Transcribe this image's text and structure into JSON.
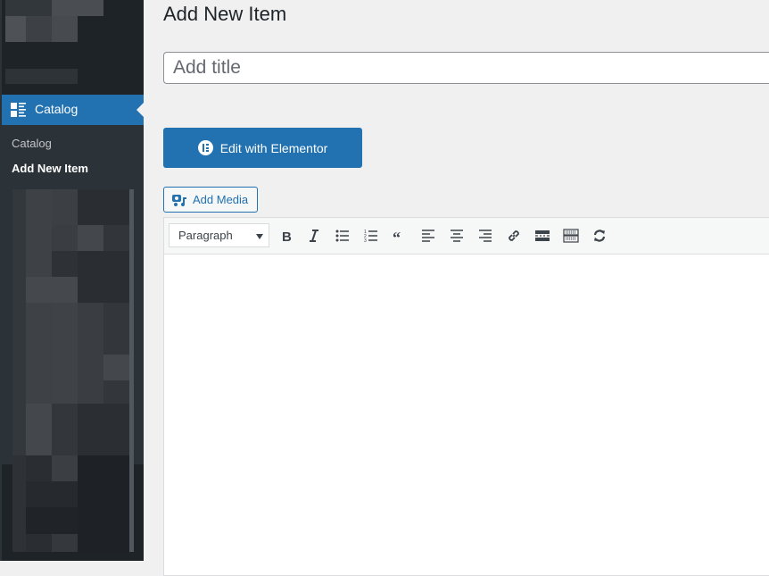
{
  "sidebar": {
    "active_menu": {
      "label": "Catalog",
      "icon": "catalog-icon"
    },
    "submenu": [
      {
        "label": "Catalog",
        "current": false
      },
      {
        "label": "Add New Item",
        "current": true
      }
    ]
  },
  "main": {
    "page_title": "Add New Item",
    "title_input": {
      "value": "",
      "placeholder": "Add title"
    },
    "elementor_button": {
      "label": "Edit with Elementor",
      "icon": "elementor-icon"
    },
    "add_media_button": {
      "label": "Add Media",
      "icon": "add-media-icon"
    },
    "editor": {
      "format_select": {
        "selected": "Paragraph"
      },
      "toolbar_buttons": [
        {
          "name": "bold",
          "icon": "bold-icon"
        },
        {
          "name": "italic",
          "icon": "italic-icon"
        },
        {
          "name": "bulleted-list",
          "icon": "bulleted-list-icon"
        },
        {
          "name": "numbered-list",
          "icon": "numbered-list-icon"
        },
        {
          "name": "blockquote",
          "icon": "blockquote-icon"
        },
        {
          "name": "align-left",
          "icon": "align-left-icon"
        },
        {
          "name": "align-center",
          "icon": "align-center-icon"
        },
        {
          "name": "align-right",
          "icon": "align-right-icon"
        },
        {
          "name": "insert-link",
          "icon": "link-icon"
        },
        {
          "name": "read-more",
          "icon": "read-more-icon"
        },
        {
          "name": "toolbar-toggle",
          "icon": "keyboard-icon"
        },
        {
          "name": "refresh",
          "icon": "refresh-icon"
        }
      ],
      "content": ""
    }
  }
}
